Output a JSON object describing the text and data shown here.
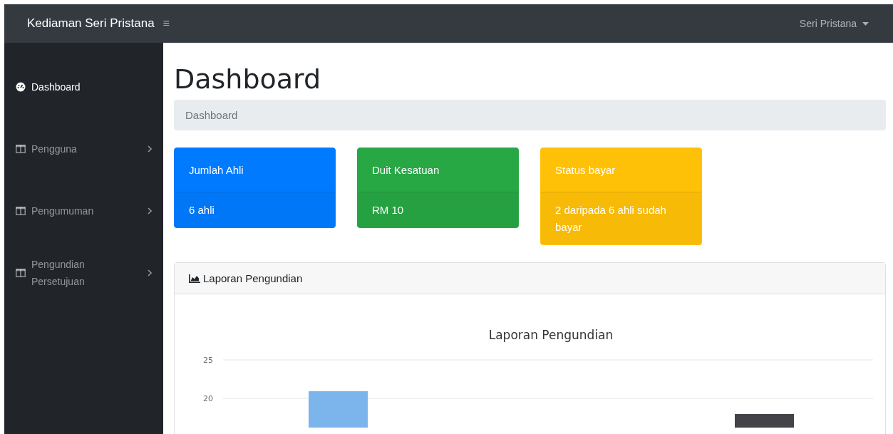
{
  "navbar": {
    "brand": "Kediaman Seri Pristana",
    "menu_toggle": "≡",
    "user": "Seri Pristana"
  },
  "sidebar": {
    "items": [
      {
        "label": "Dashboard",
        "kind": "dashboard",
        "selected": true,
        "has_submenu": false
      },
      {
        "label": "Pengguna",
        "kind": "table",
        "selected": false,
        "has_submenu": true
      },
      {
        "label": "Pengumuman",
        "kind": "table",
        "selected": false,
        "has_submenu": true
      },
      {
        "label": "Pengundian Persetujuan",
        "kind": "table",
        "selected": false,
        "has_submenu": true
      }
    ]
  },
  "page_title": "Dashboard",
  "breadcrumb": "Dashboard",
  "stat_cards": [
    {
      "title": "Jumlah Ahli",
      "value": "6 ahli",
      "color": "#007bff"
    },
    {
      "title": "Duit Kesatuan",
      "value": "RM 10",
      "color": "#28a745"
    },
    {
      "title": "Status bayar",
      "value": "2 daripada 6 ahli sudah bayar",
      "color": "#ffc107"
    }
  ],
  "chart_card": {
    "header": "Laporan Pengundian",
    "chart_title": "Laporan Pengundian",
    "y_tick_labels": [
      "25",
      "20"
    ]
  }
}
